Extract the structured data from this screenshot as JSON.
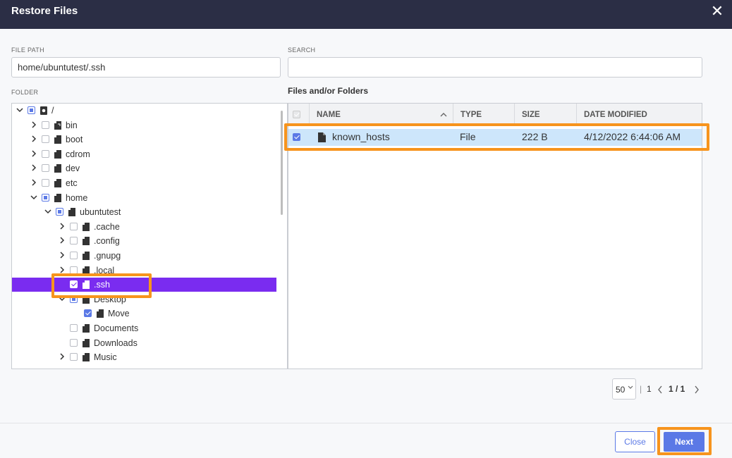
{
  "dialog": {
    "title": "Restore Files",
    "close_glyph": "✕"
  },
  "file_path": {
    "label": "FILE PATH",
    "value": "home/ubuntutest/.ssh"
  },
  "search": {
    "label": "SEARCH",
    "value": "",
    "placeholder": ""
  },
  "folder": {
    "label": "FOLDER",
    "items": [
      {
        "label": "/",
        "expanded": true,
        "check": "partial",
        "icon": "disk-icon"
      },
      {
        "label": "bin",
        "expanded": false,
        "check": "none",
        "icon": "link-folder-icon"
      },
      {
        "label": "boot",
        "expanded": false,
        "check": "none",
        "icon": "folder-icon"
      },
      {
        "label": "cdrom",
        "expanded": false,
        "check": "none",
        "icon": "folder-icon"
      },
      {
        "label": "dev",
        "expanded": false,
        "check": "none",
        "icon": "folder-icon"
      },
      {
        "label": "etc",
        "expanded": false,
        "check": "none",
        "icon": "folder-icon"
      },
      {
        "label": "home",
        "expanded": true,
        "check": "partial",
        "icon": "folder-icon"
      },
      {
        "label": "ubuntutest",
        "expanded": true,
        "check": "partial",
        "icon": "folder-icon"
      },
      {
        "label": ".cache",
        "expanded": false,
        "check": "none",
        "icon": "folder-icon"
      },
      {
        "label": ".config",
        "expanded": false,
        "check": "none",
        "icon": "folder-icon"
      },
      {
        "label": ".gnupg",
        "expanded": false,
        "check": "none",
        "icon": "folder-icon"
      },
      {
        "label": ".local",
        "expanded": false,
        "check": "none",
        "icon": "folder-icon"
      },
      {
        "label": ".ssh",
        "expanded": null,
        "check": "checked",
        "icon": "folder-icon",
        "selected": true
      },
      {
        "label": "Desktop",
        "expanded": true,
        "check": "partial",
        "icon": "folder-icon"
      },
      {
        "label": "Move",
        "expanded": null,
        "check": "checked",
        "icon": "folder-icon"
      },
      {
        "label": "Documents",
        "expanded": null,
        "check": "none",
        "icon": "folder-icon"
      },
      {
        "label": "Downloads",
        "expanded": null,
        "check": "none",
        "icon": "folder-icon"
      },
      {
        "label": "Music",
        "expanded": false,
        "check": "none",
        "icon": "folder-icon"
      }
    ]
  },
  "files": {
    "title": "Files and/or Folders",
    "columns": {
      "name": "NAME",
      "type": "TYPE",
      "size": "SIZE",
      "date": "DATE MODIFIED"
    },
    "rows": [
      {
        "name": "known_hosts",
        "type": "File",
        "size": "222 B",
        "date": "4/12/2022 6:44:06 AM",
        "checked": true,
        "icon": "file-icon"
      }
    ]
  },
  "pager": {
    "page_size": "50",
    "total_pages": "1",
    "current": "1 / 1"
  },
  "footer": {
    "close_label": "Close",
    "next_label": "Next"
  },
  "colors": {
    "titlebar": "#2b2e45",
    "accent": "#5b79e6",
    "selection": "#7a2cf0",
    "row_highlight": "#cde6fb",
    "callout": "#f7941d"
  }
}
